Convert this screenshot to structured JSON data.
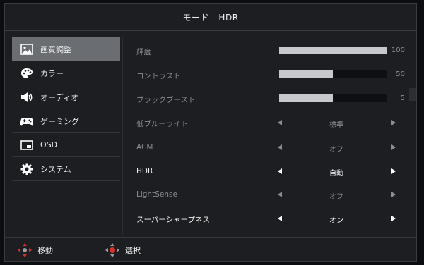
{
  "header": {
    "title": "モード - HDR"
  },
  "sidebar": {
    "items": [
      {
        "label": "画質調整",
        "icon": "picture-icon",
        "selected": true
      },
      {
        "label": "カラー",
        "icon": "palette-icon",
        "selected": false
      },
      {
        "label": "オーディオ",
        "icon": "speaker-icon",
        "selected": false
      },
      {
        "label": "ゲーミング",
        "icon": "gamepad-icon",
        "selected": false
      },
      {
        "label": "OSD",
        "icon": "osd-window-icon",
        "selected": false
      },
      {
        "label": "システム",
        "icon": "gear-icon",
        "selected": false
      }
    ]
  },
  "settings": {
    "brightness": {
      "label": "輝度",
      "value": "100",
      "level": 100
    },
    "contrast": {
      "label": "コントラスト",
      "value": "50",
      "level": 50
    },
    "black_boost": {
      "label": "ブラックブースト",
      "value": "5",
      "level": 50
    },
    "low_blue_light": {
      "label": "低ブルーライト",
      "value": "標準"
    },
    "acm": {
      "label": "ACM",
      "value": "オフ"
    },
    "hdr": {
      "label": "HDR",
      "value": "自動"
    },
    "lightsense": {
      "label": "LightSense",
      "value": "オフ"
    },
    "super_sharpness": {
      "label": "スーパーシャープネス",
      "value": "オン"
    }
  },
  "footer": {
    "move_label": "移動",
    "select_label": "選択"
  },
  "colors": {
    "selected_bg": "#6a6d72",
    "panel_bg": "#1c1e22",
    "dpad_red": "#d9312b"
  }
}
